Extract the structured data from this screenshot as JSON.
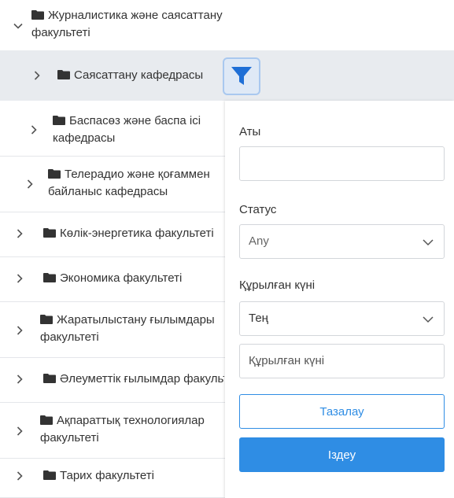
{
  "tree": {
    "items": [
      {
        "label": "Журналистика және саясаттану факультеті",
        "expanded": true,
        "level": 0
      },
      {
        "label": "Саясаттану кафедрасы",
        "expanded": false,
        "level": 1,
        "selected": true
      },
      {
        "label": "Баспасөз және баспа ісі кафедрасы",
        "expanded": false,
        "level": 1
      },
      {
        "label": "Телерадио және қоғаммен байланыс кафедрасы",
        "expanded": false,
        "level": 1
      },
      {
        "label": "Көлік-энергетика факультеті",
        "expanded": false,
        "level": 0
      },
      {
        "label": "Экономика факультеті",
        "expanded": false,
        "level": 0
      },
      {
        "label": "Жаратылыстану ғылымдары факультеті",
        "expanded": false,
        "level": 0
      },
      {
        "label": "Әлеуметтік ғылымдар факультеті",
        "expanded": false,
        "level": 0
      },
      {
        "label": "Ақпараттық технологиялар факультеті",
        "expanded": false,
        "level": 0
      },
      {
        "label": "Тарих факультеті",
        "expanded": false,
        "level": 0
      }
    ]
  },
  "filter": {
    "icon": "filter-icon",
    "name_label": "Аты",
    "name_value": "",
    "status_label": "Статус",
    "status_value": "Any",
    "created_label": "Құрылған күні",
    "created_operator": "Тең",
    "created_placeholder": "Құрылған күні",
    "clear_label": "Тазалау",
    "search_label": "Іздеу"
  },
  "colors": {
    "accent": "#2f8de4",
    "selected_row": "#e8ebef",
    "filter_icon": "#1f6fd6"
  }
}
